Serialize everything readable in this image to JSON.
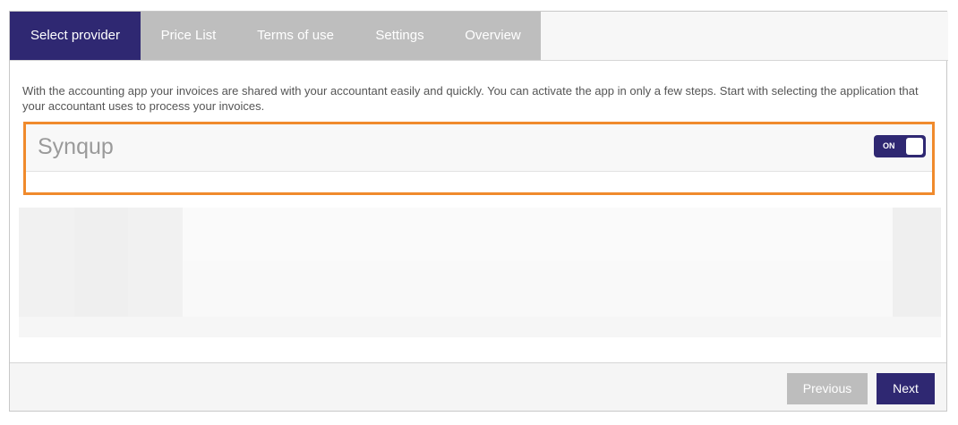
{
  "tabs": [
    {
      "label": "Select provider",
      "active": true
    },
    {
      "label": "Price List",
      "active": false
    },
    {
      "label": "Terms of use",
      "active": false
    },
    {
      "label": "Settings",
      "active": false
    },
    {
      "label": "Overview",
      "active": false
    }
  ],
  "intro_text": "With the accounting app your invoices are shared with your accountant easily and quickly. You can activate the app in only a few steps. Start with selecting the application that your accountant uses to process your invoices.",
  "provider": {
    "name": "Synqup",
    "toggle_label": "ON"
  },
  "footer": {
    "previous_label": "Previous",
    "next_label": "Next"
  },
  "colors": {
    "primary": "#2f2872",
    "inactive_tab": "#bebebe",
    "highlight_border": "#f08a2c",
    "disabled_button": "#bdbdbd"
  }
}
